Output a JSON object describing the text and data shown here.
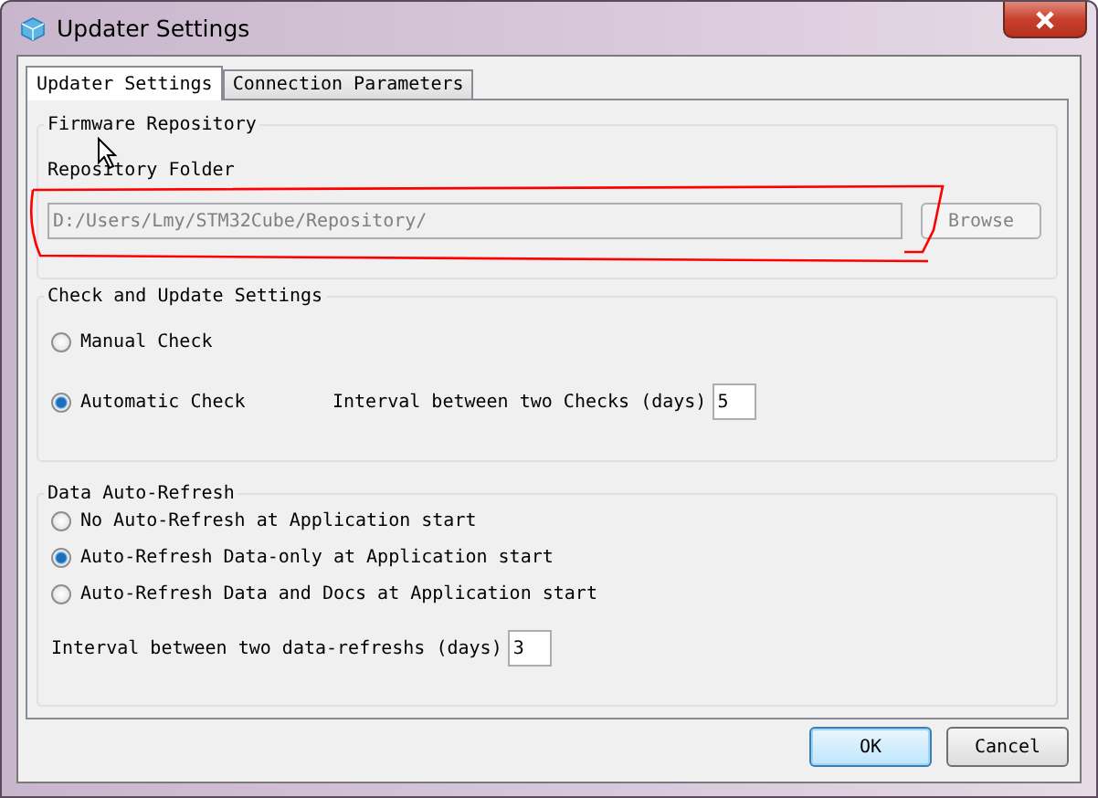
{
  "window": {
    "title": "Updater Settings"
  },
  "tabs": [
    {
      "label": "Updater Settings",
      "selected": true
    },
    {
      "label": "Connection Parameters",
      "selected": false
    }
  ],
  "firmware_repository": {
    "title": "Firmware Repository",
    "folder_label": "Repository Folder",
    "folder_path": "D:/Users/Lmy/STM32Cube/Repository/",
    "browse": {
      "label": "Browse",
      "disabled": true
    }
  },
  "check_settings": {
    "title": "Check and Update Settings",
    "options": [
      {
        "label": "Manual Check",
        "selected": false
      },
      {
        "label": "Automatic Check",
        "selected": true
      }
    ],
    "interval_label": "Interval between two Checks (days)",
    "interval_value": "5"
  },
  "data_refresh": {
    "title": "Data Auto-Refresh",
    "options": [
      {
        "label": "No Auto-Refresh at Application start",
        "selected": false
      },
      {
        "label": "Auto-Refresh Data-only at Application start",
        "selected": true
      },
      {
        "label": "Auto-Refresh Data and Docs at Application start",
        "selected": false
      }
    ],
    "interval_label": "Interval between two data-refreshs (days)",
    "interval_value": "3"
  },
  "buttons": [
    {
      "label": "OK",
      "kind": "default"
    },
    {
      "label": "Cancel",
      "kind": "normal"
    }
  ]
}
